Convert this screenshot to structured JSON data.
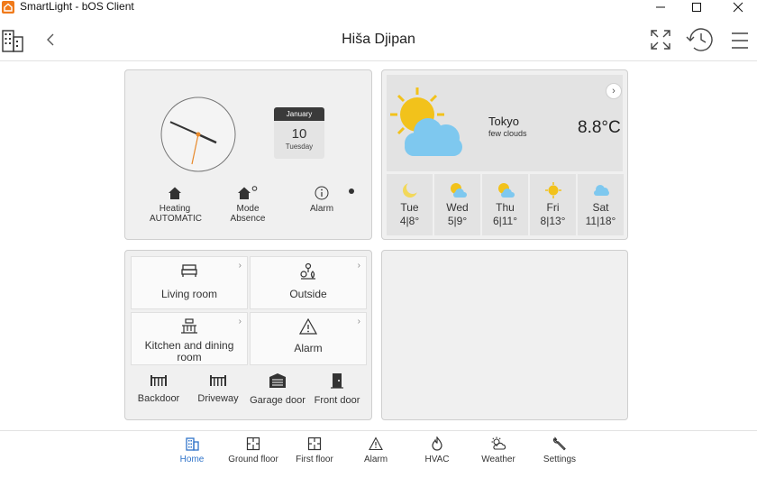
{
  "window": {
    "title": "SmartLight - bOS Client"
  },
  "header": {
    "title": "Hiša Djipan"
  },
  "clock": {
    "hour": 3,
    "minute": 49
  },
  "calendar": {
    "month": "January",
    "day": "10",
    "weekday": "Tuesday"
  },
  "status": {
    "heating": {
      "label": "Heating",
      "value": "AUTOMATIC"
    },
    "mode": {
      "label": "Mode",
      "value": "Absence"
    },
    "alarm": {
      "label": "Alarm"
    }
  },
  "weather": {
    "city": "Tokyo",
    "condition": "few clouds",
    "temperature": "8.8°C",
    "forecast": [
      {
        "day": "Tue",
        "temps": "4|8°",
        "icon": "moon-icon"
      },
      {
        "day": "Wed",
        "temps": "5|9°",
        "icon": "sun-cloud-icon"
      },
      {
        "day": "Thu",
        "temps": "6|11°",
        "icon": "sun-cloud-icon"
      },
      {
        "day": "Fri",
        "temps": "8|13°",
        "icon": "sun-icon"
      },
      {
        "day": "Sat",
        "temps": "11|18°",
        "icon": "cloud-icon"
      }
    ]
  },
  "rooms": [
    {
      "label": "Living room",
      "icon": "bed-icon"
    },
    {
      "label": "Outside",
      "icon": "plants-icon"
    },
    {
      "label": "Kitchen and dining room",
      "icon": "dining-icon"
    },
    {
      "label": "Alarm",
      "icon": "warning-icon"
    }
  ],
  "doors": [
    {
      "label": "Backdoor",
      "icon": "gate-icon"
    },
    {
      "label": "Driveway",
      "icon": "gate-icon"
    },
    {
      "label": "Garage door",
      "icon": "garage-icon"
    },
    {
      "label": "Front door",
      "icon": "door-icon"
    }
  ],
  "nav": {
    "items": [
      {
        "label": "Home",
        "icon": "building-icon",
        "active": true
      },
      {
        "label": "Ground floor",
        "icon": "floor-plan-icon",
        "active": false
      },
      {
        "label": "First floor",
        "icon": "floor-plan-icon",
        "active": false
      },
      {
        "label": "Alarm",
        "icon": "warning-icon",
        "active": false
      },
      {
        "label": "HVAC",
        "icon": "flame-icon",
        "active": false
      },
      {
        "label": "Weather",
        "icon": "weather-icon",
        "active": false
      },
      {
        "label": "Settings",
        "icon": "wrench-icon",
        "active": false
      }
    ]
  },
  "colors": {
    "accent": "#2f73c9",
    "clock_hand": "#e8892a",
    "sun": "#f2c21b",
    "cloud": "#7ec8ef"
  }
}
